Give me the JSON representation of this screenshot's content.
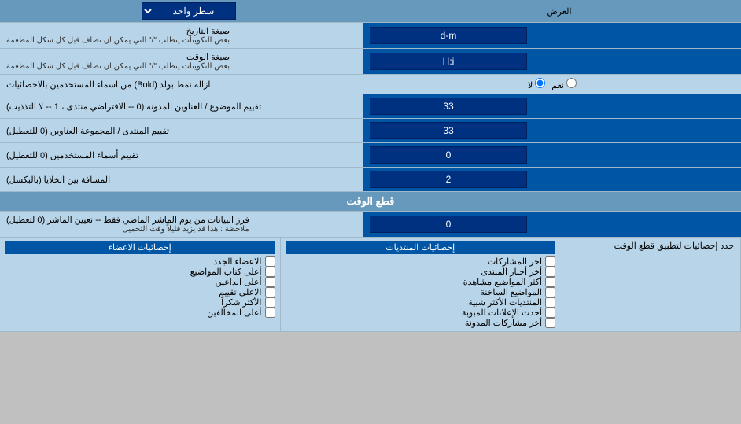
{
  "header": {
    "label": "العرض",
    "dropdown_label": "سطر واحد"
  },
  "rows": [
    {
      "id": "date_format",
      "right_label": "صيغة التاريخ",
      "right_sublabel": "بعض التكوينات يتطلب \"/\" التي يمكن ان تضاف قبل كل شكل المطعمة",
      "input_value": "d-m"
    },
    {
      "id": "time_format",
      "right_label": "صيغة الوقت",
      "right_sublabel": "بعض التكوينات يتطلب \"/\" التي يمكن ان تضاف قبل كل شكل المطعمة",
      "input_value": "H:i"
    },
    {
      "id": "bold_remove",
      "right_label": "ازالة نمط بولد (Bold) من اسماء المستخدمين بالاحصائيات",
      "radio_options": [
        "نعم",
        "لا"
      ],
      "radio_selected": 1
    },
    {
      "id": "topics_order",
      "right_label": "تقييم الموضوع / العناوين المدونة (0 -- الافتراضي منتدى ، 1 -- لا التذذيب)",
      "input_value": "33"
    },
    {
      "id": "forum_order",
      "right_label": "تقييم المنتدى / المجموعة العناوين (0 للتعطيل)",
      "input_value": "33"
    },
    {
      "id": "users_names",
      "right_label": "تقييم أسماء المستخدمين (0 للتعطيل)",
      "input_value": "0"
    },
    {
      "id": "cell_distance",
      "right_label": "المسافة بين الخلايا (بالبكسل)",
      "input_value": "2"
    }
  ],
  "section_cutoff": {
    "title": "قطع الوقت"
  },
  "cutoff_row": {
    "right_label": "فرز البيانات من يوم الماشر الماضي فقط -- تعيين الماشر (0 لتعطيل)",
    "right_sublabel": "ملاحظة : هذا قد يزيد قليلاً وقت التحميل",
    "input_value": "0"
  },
  "stats_header": {
    "label": "حدد إحصائيات لتطبيق قطع الوقت"
  },
  "col_posts": {
    "header": "إحصائيات المنتديات",
    "items": [
      "اخر المشاركات",
      "أخر أخبار المنتدى",
      "أكثر المواضيع مشاهدة",
      "المواضيع الساخنة",
      "المنتديات الأكثر شبية",
      "أحدث الإعلانات المبوبة",
      "أخر مشاركات المدونة"
    ]
  },
  "col_members": {
    "header": "إحصائيات الاعضاء",
    "items": [
      "الاعضاء الجدد",
      "أعلى كتاب المواضيع",
      "أعلى الداعين",
      "الاعلى تقييم",
      "الأكثر شكراً",
      "أعلى المخالفين"
    ]
  }
}
